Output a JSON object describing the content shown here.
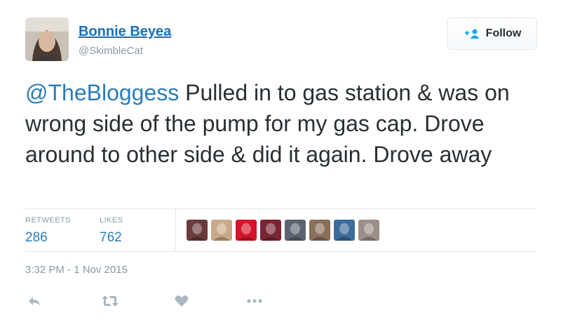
{
  "user": {
    "name": "Bonnie Beyea",
    "handle": "@SkimbleCat"
  },
  "follow_button": {
    "label": "Follow"
  },
  "tweet": {
    "mention": "@TheBloggess",
    "text": " Pulled in to gas station & was on wrong side of the pump for my gas cap. Drove around to other side & did it again. Drove away"
  },
  "stats": {
    "retweets_label": "RETWEETS",
    "retweets_count": "286",
    "likes_label": "LIKES",
    "likes_count": "762"
  },
  "likers": [
    {
      "name": "liker-1",
      "color": "#6b3a3a"
    },
    {
      "name": "liker-2",
      "color": "#c9a98a"
    },
    {
      "name": "liker-3",
      "color": "#d4142b"
    },
    {
      "name": "liker-4",
      "color": "#7a2434"
    },
    {
      "name": "liker-5",
      "color": "#5a6470"
    },
    {
      "name": "liker-6",
      "color": "#8a6f5a"
    },
    {
      "name": "liker-7",
      "color": "#3d6b9a"
    },
    {
      "name": "liker-8",
      "color": "#9c8f88"
    }
  ],
  "timestamp": "3:32 PM - 1 Nov 2015",
  "actions": [
    "reply-icon",
    "retweet-icon",
    "like-icon",
    "more-icon"
  ],
  "colors": {
    "accent": "#2b7bb9",
    "muted": "#8899a6",
    "text": "#292f33",
    "icon": "#aab8c2"
  }
}
